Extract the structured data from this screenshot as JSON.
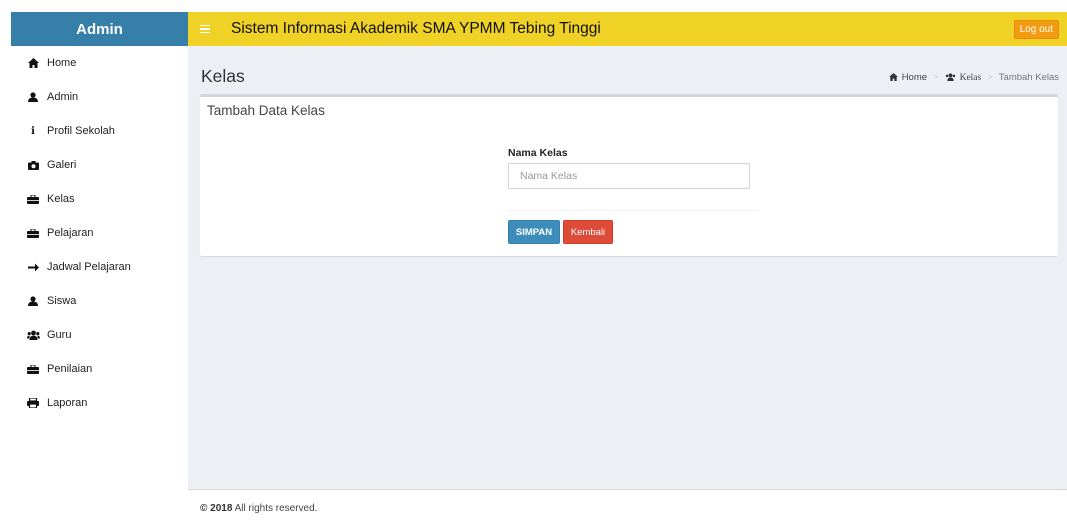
{
  "header": {
    "logo_text": "Admin",
    "app_title": "Sistem Informasi Akademik SMA YPMM Tebing Tinggi",
    "logout_label": "Log out"
  },
  "sidebar": {
    "items": [
      {
        "label": "Home",
        "icon": "home-icon"
      },
      {
        "label": "Admin",
        "icon": "user-icon"
      },
      {
        "label": "Profil Sekolah",
        "icon": "info-icon"
      },
      {
        "label": "Galeri",
        "icon": "camera-icon"
      },
      {
        "label": "Kelas",
        "icon": "briefcase-icon"
      },
      {
        "label": "Pelajaran",
        "icon": "briefcase-icon"
      },
      {
        "label": "Jadwal Pelajaran",
        "icon": "arrow-right-icon"
      },
      {
        "label": "Siswa",
        "icon": "user-icon"
      },
      {
        "label": "Guru",
        "icon": "users-icon"
      },
      {
        "label": "Penilaian",
        "icon": "briefcase-icon"
      },
      {
        "label": "Laporan",
        "icon": "print-icon"
      }
    ]
  },
  "page": {
    "title": "Kelas",
    "breadcrumb": {
      "home": "Home",
      "section": "Kelas",
      "current": "Tambah Kelas"
    }
  },
  "form": {
    "box_title": "Tambah Data Kelas",
    "field_label": "Nama Kelas",
    "field_placeholder": "Nama Kelas",
    "field_value": "",
    "save_label": "SIMPAN",
    "back_label": "Kembali"
  },
  "footer": {
    "year": "© 2018",
    "text": " All rights reserved."
  },
  "colors": {
    "header_bar": "#f0d126",
    "logo_bg": "#367fa9",
    "content_bg": "#ecf0f5",
    "save_button": "#3c8dbc",
    "back_button": "#dd4b39",
    "logout_button": "#f39c12"
  }
}
